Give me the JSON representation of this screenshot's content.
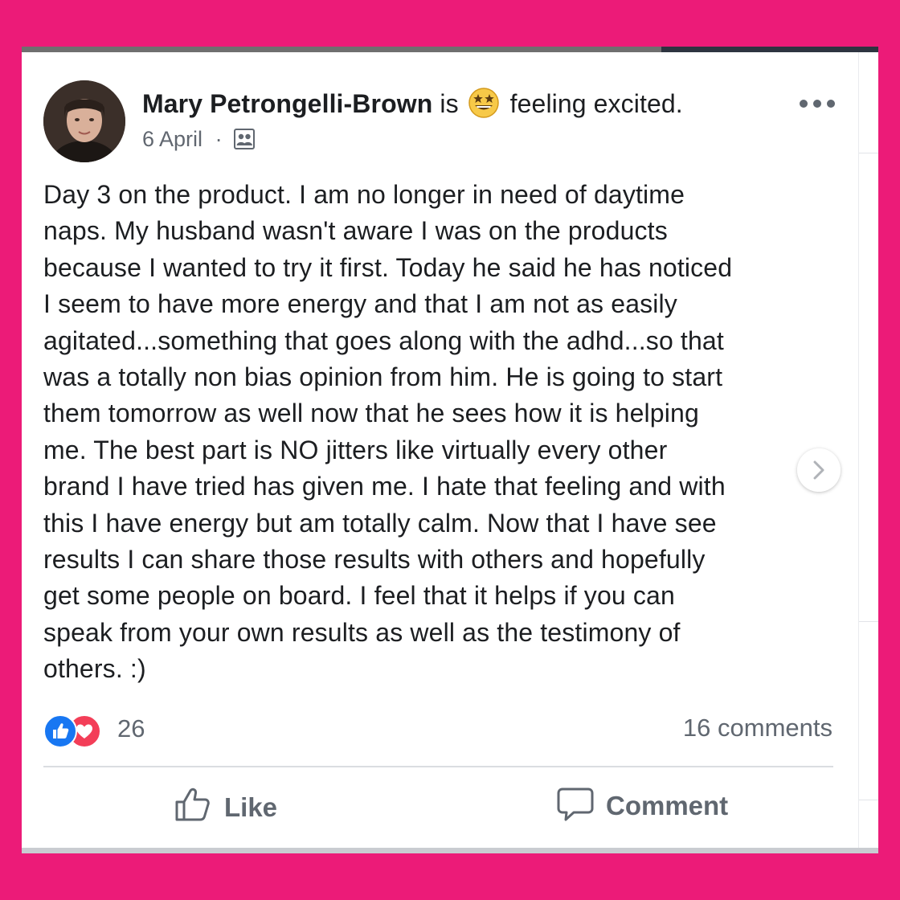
{
  "post": {
    "author": "Mary Petrongelli-Brown",
    "connector": "is",
    "feeling": "feeling excited.",
    "feeling_emoji": "grinning-star-eyes-emoji",
    "date": "6 April",
    "separator": "·",
    "audience_icon": "friends-audience-icon",
    "text_lines": [
      "Day 3 on the product. I am no longer in need of daytime",
      "naps. My husband wasn't aware I was on the products",
      "because I wanted to try it first. Today he said he has noticed",
      "I seem to have more energy and that I am not as easily",
      "agitated...something that goes along with the adhd...so that",
      "was a totally non bias opinion from him. He is going to start",
      "them tomorrow as well now that he sees how it is helping",
      "me. The best part is NO jitters like virtually every other",
      "brand I have tried has given me. I hate that feeling and with",
      "this I have energy but am totally calm. Now that I have see",
      "results I can share those results with others and hopefully",
      "get some people on board. I feel that it helps if you can",
      "speak from your own results as well as the testimony of",
      "others. :)"
    ]
  },
  "engagement": {
    "reaction_count": "26",
    "comments": "16 comments",
    "reaction_icons": [
      "like-icon",
      "love-icon"
    ]
  },
  "actions": {
    "like_label": "Like",
    "comment_label": "Comment"
  },
  "colors": {
    "background": "#ec1b78",
    "like_blue": "#1877f2",
    "love_red": "#f33e58",
    "text": "#1c1e21",
    "secondary_text": "#606770"
  }
}
